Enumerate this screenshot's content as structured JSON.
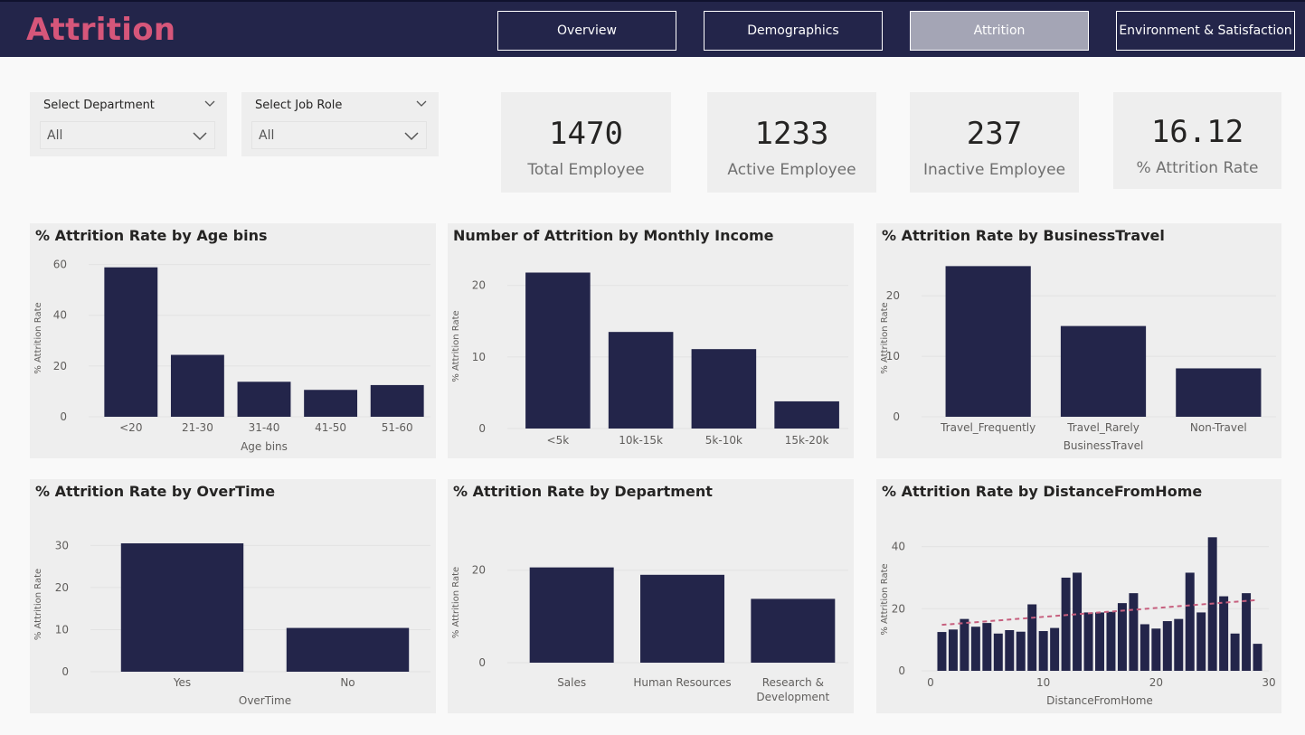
{
  "header": {
    "title": "Attrition",
    "nav": [
      {
        "label": "Overview",
        "active": false
      },
      {
        "label": "Demographics",
        "active": false
      },
      {
        "label": "Attrition",
        "active": true
      },
      {
        "label": "Environment & Satisfaction",
        "active": false
      }
    ]
  },
  "filters": [
    {
      "label": "Select Department",
      "value": "All"
    },
    {
      "label": "Select Job Role",
      "value": "All"
    }
  ],
  "kpis": [
    {
      "value": "1470",
      "label": "Total Employee"
    },
    {
      "value": "1233",
      "label": "Active Employee"
    },
    {
      "value": "237",
      "label": "Inactive Employee"
    },
    {
      "value": "16.12",
      "label": "% Attrition Rate"
    }
  ],
  "colors": {
    "bar": "#23254a",
    "trend": "#c75f7e",
    "accent": "#d6567a",
    "nav_bg": "#23254a",
    "nav_active": "#a4a5b5"
  },
  "chart_data": [
    {
      "type": "bar",
      "title": "% Attrition Rate by Age bins",
      "categories": [
        "<20",
        "21-30",
        "31-40",
        "41-50",
        "51-60"
      ],
      "values": [
        58.9,
        24.4,
        13.8,
        10.6,
        12.5
      ],
      "xlabel": "Age bins",
      "ylabel": "% Attrition Rate",
      "ylim": [
        0,
        62
      ],
      "yticks": [
        0,
        20,
        40,
        60
      ],
      "grid": true
    },
    {
      "type": "bar",
      "title": "Number of Attrition by Monthly Income",
      "categories": [
        "<5k",
        "10k-15k",
        "5k-10k",
        "15k-20k"
      ],
      "values": [
        21.8,
        13.5,
        11.1,
        3.8
      ],
      "xlabel": "",
      "ylabel": "% Attrition Rate",
      "ylim": [
        0,
        23
      ],
      "yticks": [
        0,
        10,
        20
      ],
      "grid": true
    },
    {
      "type": "bar",
      "title": "% Attrition Rate by BusinessTravel",
      "categories": [
        "Travel_Frequently",
        "Travel_Rarely",
        "Non-Travel"
      ],
      "values": [
        24.9,
        15.0,
        8.0
      ],
      "xlabel": "BusinessTravel",
      "ylabel": "% Attrition Rate",
      "ylim": [
        0,
        26
      ],
      "yticks": [
        0,
        10,
        20
      ],
      "grid": true
    },
    {
      "type": "bar",
      "title": "% Attrition Rate by OverTime",
      "categories": [
        "Yes",
        "No"
      ],
      "values": [
        30.5,
        10.4
      ],
      "xlabel": "OverTime",
      "ylabel": "% Attrition Rate",
      "ylim": [
        0,
        32
      ],
      "yticks": [
        0,
        10,
        20,
        30
      ],
      "grid": true
    },
    {
      "type": "bar",
      "title": "% Attrition Rate by Department",
      "categories": [
        "Sales",
        "Human Resources",
        "Research & Development"
      ],
      "values": [
        20.6,
        19.0,
        13.8
      ],
      "xlabel": "",
      "ylabel": "% Attrition Rate",
      "ylim": [
        0,
        26
      ],
      "yticks": [
        0,
        20
      ],
      "grid": true
    },
    {
      "type": "bar",
      "title": "% Attrition Rate by DistanceFromHome",
      "x": [
        1,
        2,
        3,
        4,
        5,
        6,
        7,
        8,
        9,
        10,
        11,
        12,
        13,
        14,
        15,
        16,
        17,
        18,
        19,
        20,
        21,
        22,
        23,
        24,
        25,
        26,
        27,
        28,
        29
      ],
      "values": [
        12.5,
        13.3,
        16.7,
        14.2,
        15.4,
        12.0,
        13.1,
        12.6,
        21.4,
        12.8,
        13.8,
        30.0,
        31.6,
        18.8,
        18.8,
        19.0,
        21.8,
        25.0,
        15.0,
        13.6,
        16.0,
        16.7,
        31.6,
        18.8,
        43.0,
        24.0,
        12.0,
        25.0,
        8.7
      ],
      "xlabel": "DistanceFromHome",
      "ylabel": "% Attrition Rate",
      "xlim": [
        0,
        30
      ],
      "xticks": [
        0,
        10,
        20,
        30
      ],
      "ylim": [
        0,
        46
      ],
      "yticks": [
        0,
        20,
        40
      ],
      "trendline": {
        "x": [
          1,
          29
        ],
        "y": [
          14.8,
          22.8
        ]
      },
      "grid": true
    }
  ]
}
